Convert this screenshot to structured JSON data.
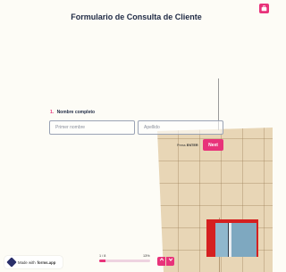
{
  "form": {
    "title": "Formulario de Consulta de Cliente",
    "question_number": "1.",
    "question_label": "Nombre completo",
    "first_name_placeholder": "Primer nombre",
    "last_name_placeholder": "Apellido",
    "press_prefix": "Press",
    "press_key": "ENTER",
    "next_label": "Next"
  },
  "badge": {
    "prefix": "Made with",
    "brand": "forms.app"
  },
  "progress": {
    "count_text": "1 / 8",
    "percent_text": "13%",
    "value": 0.13
  },
  "icons": {
    "top_right": "briefcase-icon",
    "nav_up": "chevron-up-icon",
    "nav_down": "chevron-down-icon",
    "badge_logo": "forms-app-logo-icon"
  },
  "colors": {
    "accent": "#e8337a",
    "text": "#1f2a44",
    "background": "#fdfcf6"
  }
}
